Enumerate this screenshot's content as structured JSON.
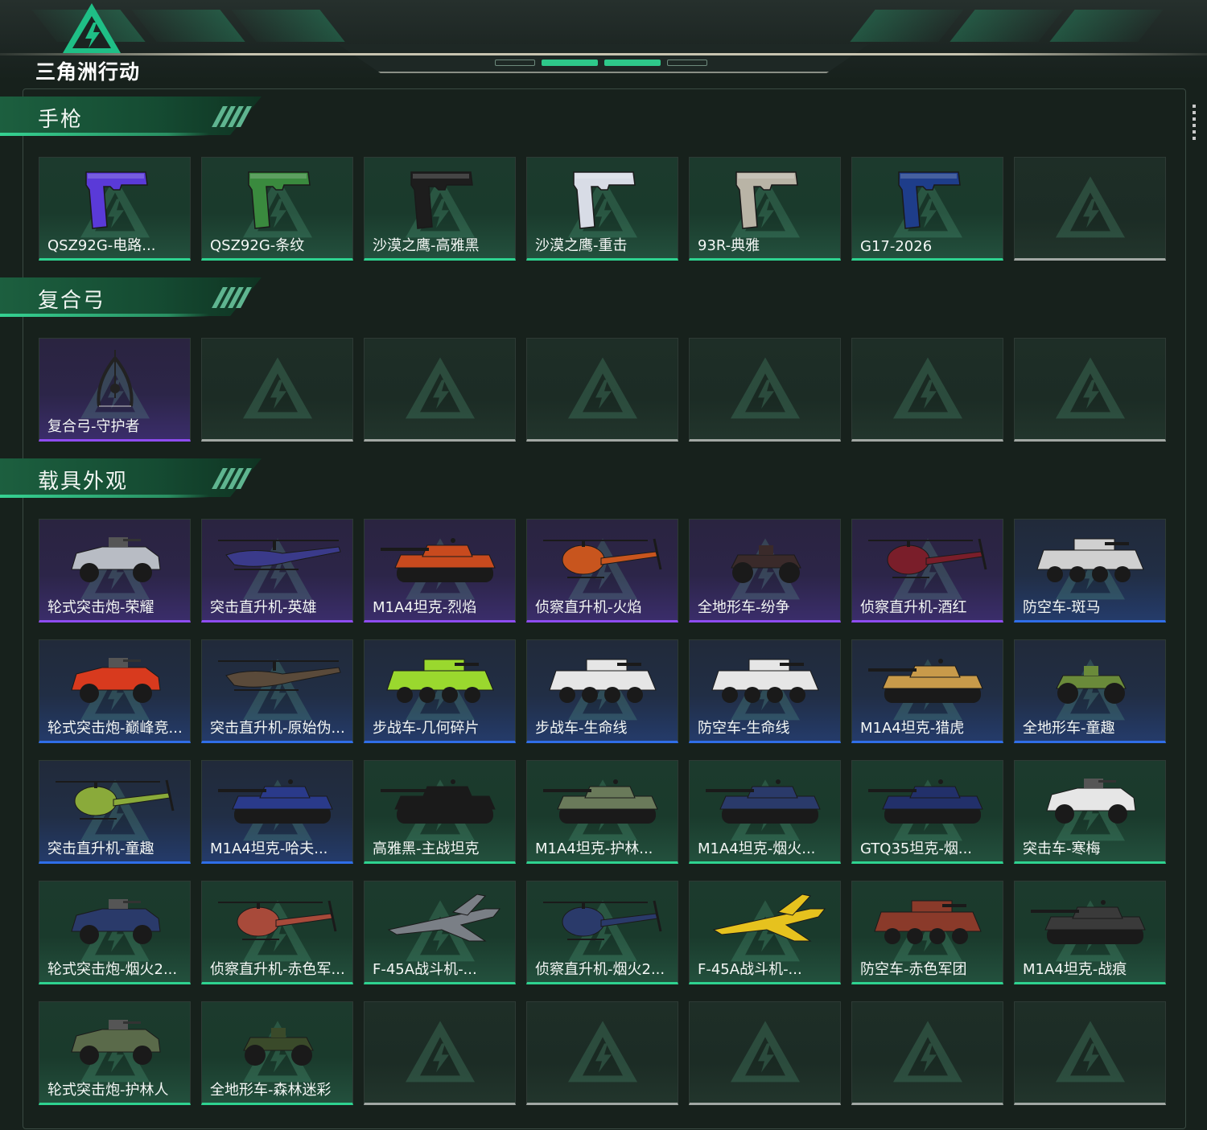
{
  "app": {
    "logo_text": "三角洲行动"
  },
  "colors": {
    "accent": "#2ed390",
    "purple_rarity": "#8e4cf0",
    "blue_rarity": "#2f6ee8",
    "green_rarity": "#2ed390",
    "empty": "#a2a8a4"
  },
  "sections": [
    {
      "title": "手枪",
      "items": [
        {
          "label": "QSZ92G-电路...",
          "rarity": "green",
          "icon": "pistol-icon",
          "color": "#5a3ad8"
        },
        {
          "label": "QSZ92G-条纹",
          "rarity": "green",
          "icon": "pistol-icon",
          "color": "#3a8a3e"
        },
        {
          "label": "沙漠之鹰-高雅黑",
          "rarity": "green",
          "icon": "pistol-icon",
          "color": "#1d1d1d"
        },
        {
          "label": "沙漠之鹰-重击",
          "rarity": "green",
          "icon": "pistol-icon",
          "color": "#d8dce6"
        },
        {
          "label": "93R-典雅",
          "rarity": "green",
          "icon": "pistol-icon",
          "color": "#b9b4a6"
        },
        {
          "label": "G17-2026",
          "rarity": "green",
          "icon": "pistol-icon",
          "color": "#1e3d8a"
        },
        {
          "label": "",
          "rarity": "empty",
          "icon": "empty-slot-icon",
          "color": ""
        }
      ]
    },
    {
      "title": "复合弓",
      "items": [
        {
          "label": "复合弓-守护者",
          "rarity": "purple",
          "icon": "bow-icon",
          "color": "#222222"
        },
        {
          "label": "",
          "rarity": "empty",
          "icon": "empty-slot-icon",
          "color": ""
        },
        {
          "label": "",
          "rarity": "empty",
          "icon": "empty-slot-icon",
          "color": ""
        },
        {
          "label": "",
          "rarity": "empty",
          "icon": "empty-slot-icon",
          "color": ""
        },
        {
          "label": "",
          "rarity": "empty",
          "icon": "empty-slot-icon",
          "color": ""
        },
        {
          "label": "",
          "rarity": "empty",
          "icon": "empty-slot-icon",
          "color": ""
        },
        {
          "label": "",
          "rarity": "empty",
          "icon": "empty-slot-icon",
          "color": ""
        }
      ]
    },
    {
      "title": "载具外观",
      "items": [
        {
          "label": "轮式突击炮-荣耀",
          "rarity": "purple",
          "icon": "armored-car-icon",
          "color": "#b8bcc4"
        },
        {
          "label": "突击直升机-英雄",
          "rarity": "purple",
          "icon": "attack-helicopter-icon",
          "color": "#3a3a8a"
        },
        {
          "label": "M1A4坦克-烈焰",
          "rarity": "purple",
          "icon": "tank-icon",
          "color": "#c84a1e"
        },
        {
          "label": "侦察直升机-火焰",
          "rarity": "purple",
          "icon": "scout-helicopter-icon",
          "color": "#c8551e"
        },
        {
          "label": "全地形车-纷争",
          "rarity": "purple",
          "icon": "atv-icon",
          "color": "#3a2a2a"
        },
        {
          "label": "侦察直升机-酒红",
          "rarity": "purple",
          "icon": "scout-helicopter-icon",
          "color": "#7a1e2a"
        },
        {
          "label": "防空车-斑马",
          "rarity": "blue",
          "icon": "apc-icon",
          "color": "#d0d0d0"
        },
        {
          "label": "轮式突击炮-巅峰竞...",
          "rarity": "blue",
          "icon": "armored-car-icon",
          "color": "#d83a1e"
        },
        {
          "label": "突击直升机-原始伪...",
          "rarity": "blue",
          "icon": "attack-helicopter-icon",
          "color": "#5a4a3a"
        },
        {
          "label": "步战车-几何碎片",
          "rarity": "blue",
          "icon": "apc-icon",
          "color": "#9ad82e"
        },
        {
          "label": "步战车-生命线",
          "rarity": "blue",
          "icon": "apc-icon",
          "color": "#e6e6e6"
        },
        {
          "label": "防空车-生命线",
          "rarity": "blue",
          "icon": "apc-icon",
          "color": "#e6e6e6"
        },
        {
          "label": "M1A4坦克-猎虎",
          "rarity": "blue",
          "icon": "tank-icon",
          "color": "#c89a4a"
        },
        {
          "label": "全地形车-童趣",
          "rarity": "blue",
          "icon": "atv-icon",
          "color": "#6a8a3a"
        },
        {
          "label": "突击直升机-童趣",
          "rarity": "blue",
          "icon": "scout-helicopter-icon",
          "color": "#8aaa3a"
        },
        {
          "label": "M1A4坦克-哈夫...",
          "rarity": "blue",
          "icon": "tank-icon",
          "color": "#2a3a8a"
        },
        {
          "label": "高雅黑-主战坦克",
          "rarity": "green",
          "icon": "tank-icon",
          "color": "#1a1a1a"
        },
        {
          "label": "M1A4坦克-护林...",
          "rarity": "green",
          "icon": "tank-icon",
          "color": "#6a7a5a"
        },
        {
          "label": "M1A4坦克-烟火...",
          "rarity": "green",
          "icon": "tank-icon",
          "color": "#2a3a6a"
        },
        {
          "label": "GTQ35坦克-烟...",
          "rarity": "green",
          "icon": "tank-icon",
          "color": "#22306a"
        },
        {
          "label": "突击车-寒梅",
          "rarity": "green",
          "icon": "armored-car-icon",
          "color": "#e6e6e6"
        },
        {
          "label": "轮式突击炮-烟火2...",
          "rarity": "green",
          "icon": "armored-car-icon",
          "color": "#2a3a6a"
        },
        {
          "label": "侦察直升机-赤色军...",
          "rarity": "green",
          "icon": "scout-helicopter-icon",
          "color": "#a84a3a"
        },
        {
          "label": "F-45A战斗机-...",
          "rarity": "green",
          "icon": "fighter-jet-icon",
          "color": "#7a7f86"
        },
        {
          "label": "侦察直升机-烟火2...",
          "rarity": "green",
          "icon": "scout-helicopter-icon",
          "color": "#2a3a6a"
        },
        {
          "label": "F-45A战斗机-...",
          "rarity": "green",
          "icon": "fighter-jet-icon",
          "color": "#e6c21e"
        },
        {
          "label": "防空车-赤色军团",
          "rarity": "green",
          "icon": "apc-icon",
          "color": "#8a3a2a"
        },
        {
          "label": "M1A4坦克-战痕",
          "rarity": "green",
          "icon": "tank-icon",
          "color": "#3a3a3a"
        },
        {
          "label": "轮式突击炮-护林人",
          "rarity": "green",
          "icon": "armored-car-icon",
          "color": "#5a6a4a"
        },
        {
          "label": "全地形车-森林迷彩",
          "rarity": "green",
          "icon": "atv-icon",
          "color": "#3a4a2a"
        },
        {
          "label": "",
          "rarity": "empty",
          "icon": "empty-slot-icon",
          "color": ""
        },
        {
          "label": "",
          "rarity": "empty",
          "icon": "empty-slot-icon",
          "color": ""
        },
        {
          "label": "",
          "rarity": "empty",
          "icon": "empty-slot-icon",
          "color": ""
        },
        {
          "label": "",
          "rarity": "empty",
          "icon": "empty-slot-icon",
          "color": ""
        },
        {
          "label": "",
          "rarity": "empty",
          "icon": "empty-slot-icon",
          "color": ""
        }
      ]
    }
  ]
}
